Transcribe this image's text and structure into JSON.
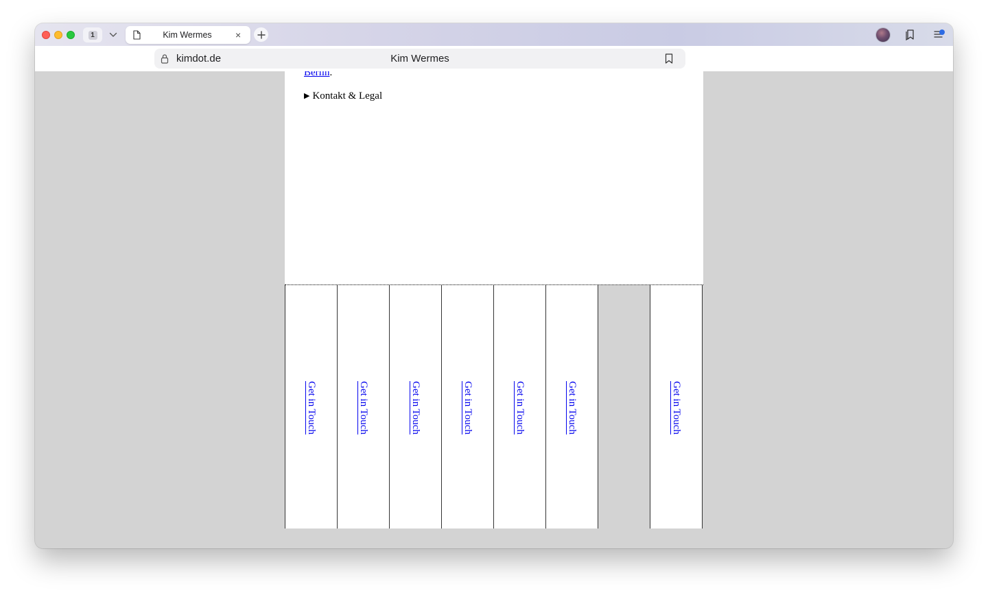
{
  "browser": {
    "tab_count": "1",
    "tab_title": "Kim Wermes",
    "tab_close_glyph": "×",
    "url_host": "kimdot.de",
    "page_title": "Kim Wermes",
    "icons": [
      "tab-overview-icon",
      "chevron-down-icon",
      "document-icon",
      "close-icon",
      "plus-icon",
      "profile-avatar",
      "reading-list-icon",
      "sidebar-menu-icon",
      "lock-icon",
      "bookmark-icon"
    ]
  },
  "page": {
    "berlin_link": "Berlin",
    "berlin_suffix": ".",
    "details_summary": "Kontakt & Legal",
    "details_triangle": "▶",
    "columns": [
      {
        "link": "Get in Touch",
        "empty": false
      },
      {
        "link": "Get in Touch",
        "empty": false
      },
      {
        "link": "Get in Touch",
        "empty": false
      },
      {
        "link": "Get in Touch",
        "empty": false
      },
      {
        "link": "Get in Touch",
        "empty": false
      },
      {
        "link": "Get in Touch",
        "empty": false
      },
      {
        "link": "",
        "empty": true
      },
      {
        "link": "Get in Touch",
        "empty": false
      }
    ]
  },
  "colors": {
    "link": "#0000ee",
    "page_background": "#d3d3d3",
    "close_red": "#fe5f57",
    "minimize_yellow": "#febc2e",
    "zoom_green": "#28c840",
    "badge_blue": "#2d6be4"
  }
}
